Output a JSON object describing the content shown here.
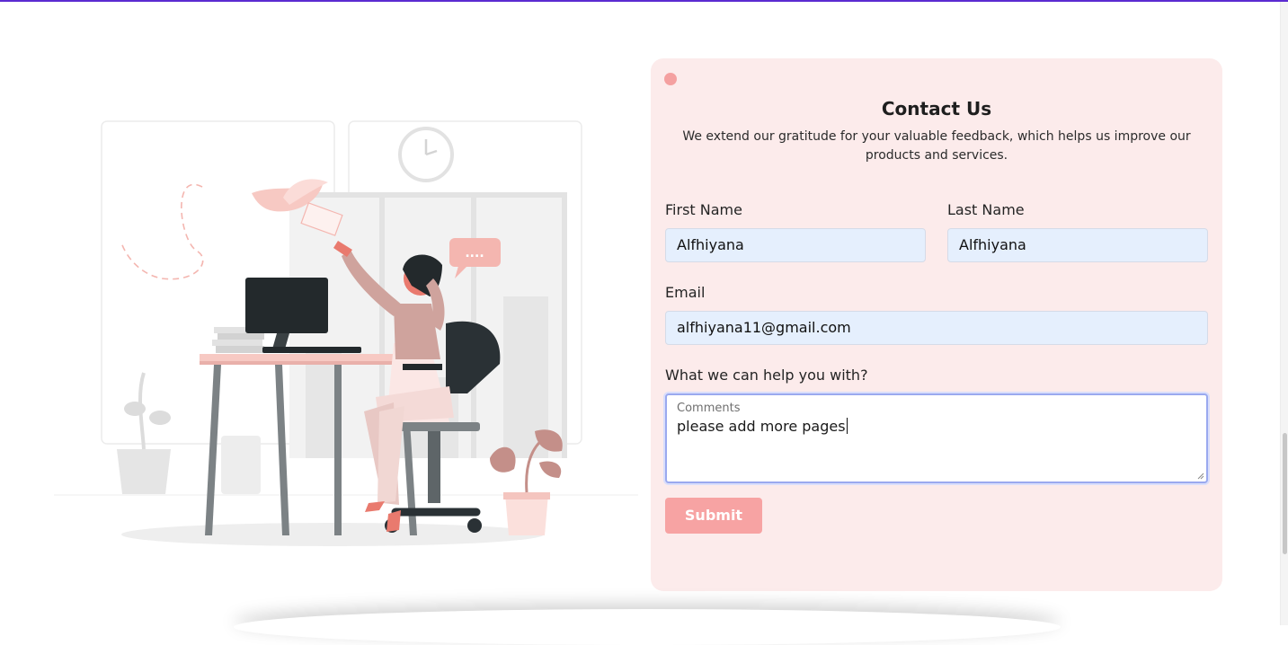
{
  "colors": {
    "accent_top_bar": "#5b2bd1",
    "card_background": "#fcebeb",
    "input_background": "#e5effd",
    "submit_button": "#f7a3a3",
    "illustration_pink": "#f4b6b0"
  },
  "contact": {
    "title": "Contact Us",
    "subtitle": "We extend our gratitude for your valuable feedback, which helps us improve our products and services.",
    "first_name": {
      "label": "First Name",
      "value": "Alfhiyana"
    },
    "last_name": {
      "label": "Last Name",
      "value": "Alfhiyana"
    },
    "email": {
      "label": "Email",
      "value": "alfhiyana11@gmail.com"
    },
    "help": {
      "label": "What we can help you with?",
      "placeholder": "Comments",
      "value": "please add more pages"
    },
    "submit_label": "Submit"
  },
  "illustration": {
    "icon": "customer-support-illustration",
    "bubble_text": "...."
  }
}
